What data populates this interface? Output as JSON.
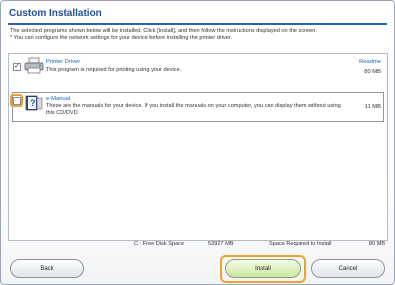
{
  "dialog": {
    "title": "Custom Installation",
    "instructions": [
      "The selected programs shown below will be installed. Click [Install], and then follow the instructions displayed on the screen.",
      "* You can configure the network settings for your device before installing the printer driver."
    ]
  },
  "items": [
    {
      "name": "Printer Driver",
      "description": "This program is required for printing using your device.",
      "link": "Readme",
      "size": "80 MB",
      "checked": true,
      "icon": "printer-icon"
    },
    {
      "name": "e-Manual",
      "description": "These are the manuals for your device. If you install the manuals on your computer, you can display them without using this CD/DVD.",
      "link": "",
      "size": "11 MB",
      "checked": false,
      "icon": "manual-icon"
    }
  ],
  "status": {
    "disk_label": "C : Free Disk Space",
    "disk_value": "53927 MB",
    "required_label": "Space Required to Install",
    "required_value": "80 MB"
  },
  "buttons": {
    "back": "Back",
    "install": "Install",
    "cancel": "Cancel"
  },
  "colors": {
    "title": "#1d4f9c",
    "link": "#1d5fc4",
    "highlight": "#f0a030",
    "install_button": "#dff2c3"
  }
}
